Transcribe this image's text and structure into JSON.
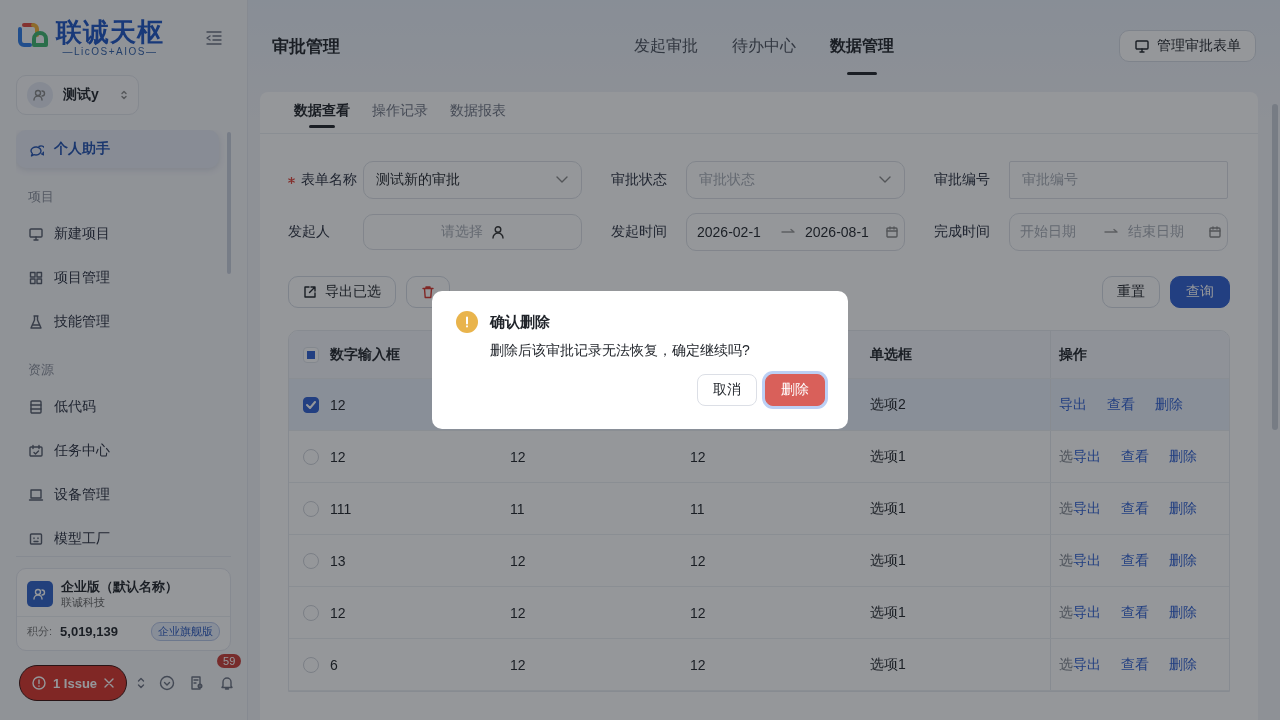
{
  "sidebar": {
    "logo": {
      "title": "联诚天枢",
      "subtitle": "—LicOS+AIOS—"
    },
    "workspace": "测试y",
    "items": [
      {
        "kind": "item",
        "label": "个人助手",
        "selected": true
      },
      {
        "kind": "section",
        "label": "项目"
      },
      {
        "kind": "item",
        "label": "新建项目",
        "selected": false
      },
      {
        "kind": "item",
        "label": "项目管理",
        "selected": false
      },
      {
        "kind": "item",
        "label": "技能管理",
        "selected": false
      },
      {
        "kind": "section",
        "label": "资源"
      },
      {
        "kind": "item",
        "label": "低代码",
        "selected": false
      },
      {
        "kind": "item",
        "label": "任务中心",
        "selected": false
      },
      {
        "kind": "item",
        "label": "设备管理",
        "selected": false
      },
      {
        "kind": "item",
        "label": "模型工厂",
        "selected": false
      }
    ],
    "org": {
      "name": "企业版（默认名称）",
      "company": "联诚科技",
      "points_label": "积分:",
      "points": "5,019,139",
      "plan": "企业旗舰版"
    },
    "issue": "1 Issue",
    "notification_count": "59"
  },
  "header": {
    "title": "审批管理",
    "nav": [
      {
        "label": "发起审批",
        "selected": false
      },
      {
        "label": "待办中心",
        "selected": false
      },
      {
        "label": "数据管理",
        "selected": true
      }
    ],
    "action": "管理审批表单"
  },
  "subtabs": [
    {
      "label": "数据查看",
      "selected": true
    },
    {
      "label": "操作记录",
      "selected": false
    },
    {
      "label": "数据报表",
      "selected": false
    }
  ],
  "filters": [
    {
      "kind": "select",
      "label": "表单名称",
      "required": true,
      "value": "测试新的审批"
    },
    {
      "kind": "select",
      "label": "审批状态",
      "placeholder": "审批状态"
    },
    {
      "kind": "input",
      "label": "审批编号",
      "placeholder": "审批编号"
    },
    {
      "kind": "user",
      "label": "发起人",
      "placeholder": "请选择"
    },
    {
      "kind": "range",
      "label": "发起时间",
      "start": "2026-02-1",
      "end": "2026-08-1"
    },
    {
      "kind": "range",
      "label": "完成时间",
      "start_placeholder": "开始日期",
      "end_placeholder": "结束日期"
    }
  ],
  "toolbar": {
    "left": [
      {
        "kind": "export",
        "label": "导出已选"
      },
      {
        "kind": "delete"
      }
    ],
    "right": [
      {
        "label": "重置",
        "primary": false
      },
      {
        "label": "查询",
        "primary": true
      }
    ]
  },
  "table": {
    "select_all": {
      "indeterminate": true
    },
    "column_1": "数字输入框",
    "column_4": "单选框",
    "actions": "操作",
    "rows": [
      {
        "selected": true,
        "cells": [
          "12",
          null,
          null,
          "选项2"
        ],
        "actions": [
          "导出",
          "查看",
          "删除"
        ]
      },
      {
        "selected": false,
        "cells": [
          "12",
          "12",
          "12",
          "选项1"
        ],
        "hidden_text": "选",
        "actions": [
          "导出",
          "查看",
          "删除"
        ]
      },
      {
        "selected": false,
        "cells": [
          "111",
          "11",
          "11",
          "选项1"
        ],
        "hidden_text": "选",
        "actions": [
          "导出",
          "查看",
          "删除"
        ]
      },
      {
        "selected": false,
        "cells": [
          "13",
          "12",
          "12",
          "选项1"
        ],
        "hidden_text": "选",
        "actions": [
          "导出",
          "查看",
          "删除"
        ]
      },
      {
        "selected": false,
        "cells": [
          "12",
          "12",
          "12",
          "选项1"
        ],
        "hidden_text": "选",
        "actions": [
          "导出",
          "查看",
          "删除"
        ]
      },
      {
        "selected": false,
        "cells": [
          "6",
          "12",
          "12",
          "选项1"
        ],
        "hidden_text": "选",
        "actions": [
          "导出",
          "查看",
          "删除"
        ]
      }
    ]
  },
  "dialog": {
    "title": "确认删除",
    "message": "删除后该审批记录无法恢复，确定继续吗?",
    "buttons": [
      {
        "label": "取消",
        "primary": false
      },
      {
        "label": "删除",
        "primary": true
      }
    ]
  }
}
